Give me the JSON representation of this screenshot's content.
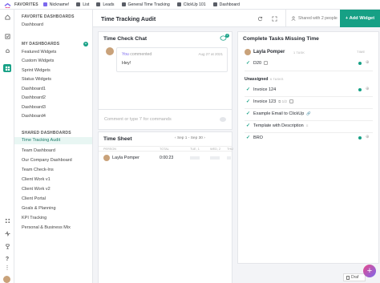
{
  "favorites": {
    "label": "FAVORITES",
    "items": [
      {
        "label": "Nickname!",
        "color": "#7b68ee"
      },
      {
        "label": "List",
        "color": "#595d66"
      },
      {
        "label": "Leads",
        "color": "#595d66"
      },
      {
        "label": "General Time Tracking",
        "color": "#595d66"
      },
      {
        "label": "ClickUp 101",
        "color": "#595d66"
      },
      {
        "label": "Dashboard",
        "color": "#595d66"
      }
    ]
  },
  "sidebar": {
    "favorite_heading": "FAVORITE DASHBOARDS",
    "favorite_items": [
      "Dashboard"
    ],
    "my_heading": "MY DASHBOARDS",
    "my_items": [
      "Featured Widgets",
      "Custom Widgets",
      "Sprint Widgets",
      "Status Widgets",
      "Dashboard1",
      "Dashboard2",
      "Dashboard3",
      "Dashboard4"
    ],
    "shared_heading": "SHARED DASHBOARDS",
    "shared_items": [
      "Time Tracking Audit",
      "Team Dashboard",
      "Our Company Dashboard",
      "Team Check-Ins",
      "Client Work v1",
      "Client Work v2",
      "Client Portal",
      "Goals & Planning",
      "KPI Tracking",
      "Personal & Business Mix"
    ],
    "active_item": "Time Tracking Audit"
  },
  "header": {
    "title": "Time Tracking Audit",
    "shared_text": "Shared with 2 people",
    "add_widget": "+ Add Widget"
  },
  "chat": {
    "title": "Time Check Chat",
    "badge": "2",
    "author": "You",
    "action": "commented",
    "date": "Aug 27 at 2021",
    "message": "Hey!",
    "input_placeholder": "Comment or type '/' for commands"
  },
  "timesheet": {
    "title": "Time Sheet",
    "range": "Sep 1 - Sep 30",
    "columns": [
      "PERSON",
      "TOTAL",
      "TUE, 1",
      "WED, 2",
      "THU"
    ],
    "rows": [
      {
        "person": "Layla Pomper",
        "total": "0:00:23"
      }
    ]
  },
  "missing": {
    "title": "Complete Tasks Missing Time",
    "user": "Layla Pomper",
    "user_count": "1 TASK",
    "status_header": "TIME",
    "task_top": "D20",
    "unassigned_label": "Unassigned",
    "unassigned_count": "6 TASKS",
    "tasks": [
      {
        "name": "Invoice 124",
        "extra": ""
      },
      {
        "name": "Invoice 123",
        "extra": "⧉ 1/2"
      },
      {
        "name": "Example Email to ClickUp",
        "extra": "🔗"
      },
      {
        "name": "Template with Description",
        "extra": "≡"
      },
      {
        "name": "BRO",
        "extra": ""
      }
    ]
  },
  "footer": {
    "drafts": "Draf"
  },
  "colors": {
    "accent": "#16a085",
    "brand": "#7b68ee"
  }
}
